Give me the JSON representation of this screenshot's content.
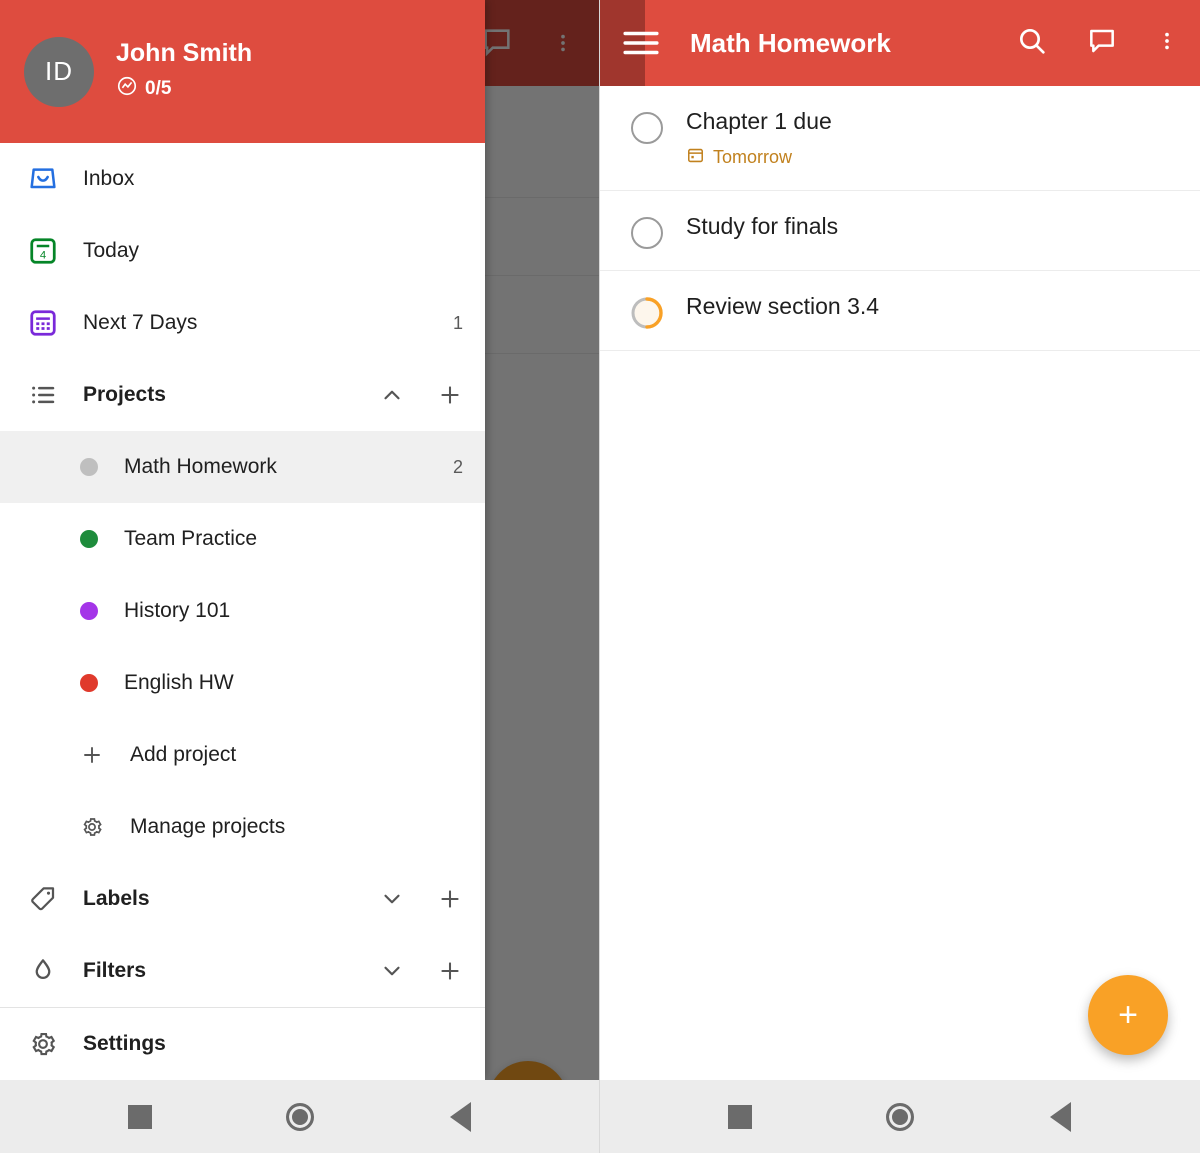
{
  "colors": {
    "brand_red": "#DE4C3F",
    "accent_orange": "#F9A126",
    "due_orange": "#C1811E",
    "inbox_blue": "#246FE0",
    "today_green": "#058527",
    "next7_purple": "#7A29D9",
    "avatar_gray": "#6E6E6E",
    "selected_row": "#F0F0F0",
    "navbar_gray": "#ECECEC"
  },
  "drawer": {
    "header": {
      "avatar_initials": "ID",
      "user_name": "John Smith",
      "karma_icon": "karma-trend-icon",
      "karma_value": "0/5"
    },
    "nav_items": [
      {
        "icon": "inbox-icon",
        "label": "Inbox",
        "count": ""
      },
      {
        "icon": "today-calendar-icon",
        "label": "Today",
        "count": ""
      },
      {
        "icon": "next7days-calendar-icon",
        "label": "Next 7 Days",
        "count": "1"
      }
    ],
    "projects_section": {
      "icon": "list-icon",
      "label": "Projects",
      "collapse_icon": "chevron-up-icon",
      "add_icon": "plus-icon",
      "items": [
        {
          "label": "Math Homework",
          "dot": "#BFBFBF",
          "count": "2",
          "selected": true
        },
        {
          "label": "Team Practice",
          "dot": "#1E8C3C",
          "count": "",
          "selected": false
        },
        {
          "label": "History 101",
          "dot": "#A435E8",
          "count": "",
          "selected": false
        },
        {
          "label": "English HW",
          "dot": "#E03A2C",
          "count": "",
          "selected": false
        }
      ],
      "actions": [
        {
          "icon": "plus-icon",
          "label": "Add project"
        },
        {
          "icon": "gear-icon",
          "label": "Manage projects"
        }
      ]
    },
    "labels_section": {
      "icon": "tag-icon",
      "label": "Labels",
      "collapse_icon": "chevron-down-icon",
      "add_icon": "plus-icon"
    },
    "filters_section": {
      "icon": "droplet-icon",
      "label": "Filters",
      "collapse_icon": "chevron-down-icon",
      "add_icon": "plus-icon"
    },
    "footer": {
      "icon": "gear-icon",
      "label": "Settings"
    }
  },
  "right_screen": {
    "appbar": {
      "menu_icon": "hamburger-menu-icon",
      "title": "Math Homework",
      "search_icon": "search-icon",
      "comment_icon": "comment-icon",
      "overflow_icon": "more-vertical-icon"
    },
    "tasks": [
      {
        "title": "Chapter 1 due",
        "due": "Tomorrow",
        "due_icon": "calendar-small-icon",
        "state": "empty"
      },
      {
        "title": "Study for finals",
        "due": "",
        "due_icon": "",
        "state": "empty"
      },
      {
        "title": "Review section 3.4",
        "due": "",
        "due_icon": "",
        "state": "loading"
      }
    ],
    "fab": {
      "icon": "plus-icon",
      "label": "Add task"
    }
  },
  "navbar": {
    "recents_icon": "square-recents-icon",
    "home_icon": "circle-home-icon",
    "back_icon": "triangle-back-icon"
  }
}
